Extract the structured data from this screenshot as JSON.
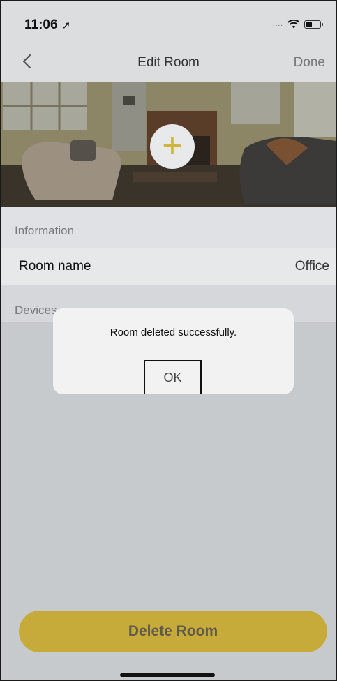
{
  "status_bar": {
    "time": "11:06",
    "location_icon": "location-arrow-icon",
    "signal_dots": "....",
    "wifi_icon": "wifi-icon",
    "battery_icon": "battery-icon"
  },
  "nav": {
    "back_icon": "chevron-left-icon",
    "title": "Edit Room",
    "done_label": "Done"
  },
  "room_photo": {
    "add_icon": "plus-icon",
    "accent_color": "#cfb53a"
  },
  "information": {
    "section_label": "Information",
    "room_name_label": "Room name",
    "room_name_value": "Office"
  },
  "devices": {
    "section_label": "Devices"
  },
  "alert": {
    "message": "Room deleted successfully.",
    "ok_label": "OK"
  },
  "footer": {
    "delete_label": "Delete Room",
    "delete_color": "#c7ab3a"
  }
}
